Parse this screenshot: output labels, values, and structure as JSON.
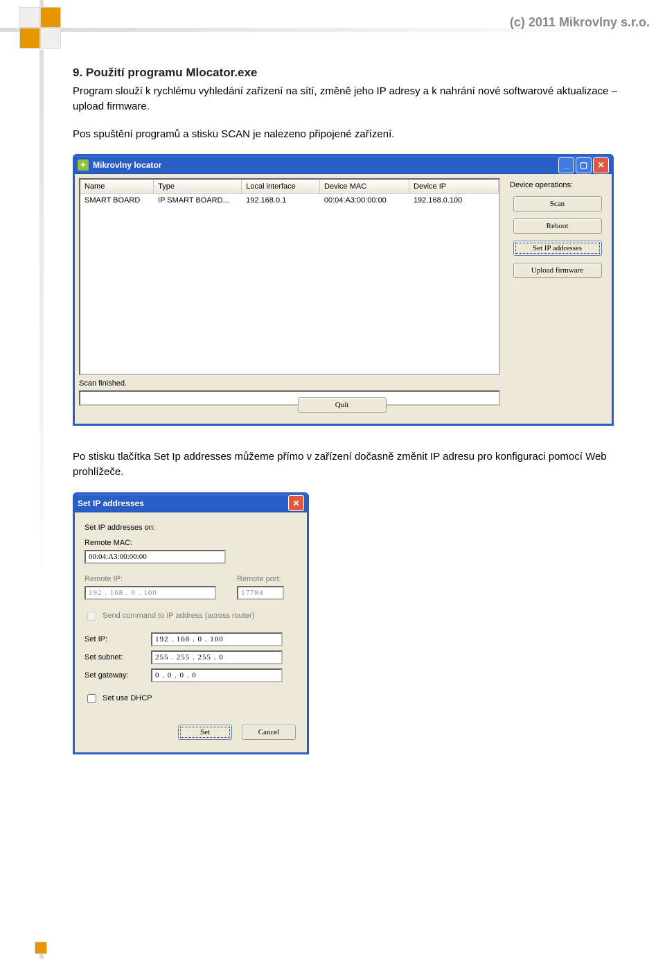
{
  "page": {
    "copyright": "(c) 2011 Mikrovlny s.r.o.",
    "heading": "9. Použití programu Mlocator.exe",
    "para1": "Program slouží k rychlému vyhledání zařízení na sítí, změně jeho IP adresy a k nahrání nové softwarové aktualizace – upload firmware.",
    "para2": "Pos spuštění programů a stisku SCAN je nalezeno připojené zařízení.",
    "para3": "Po stisku tlačítka Set Ip addresses můžeme přímo v zařízení dočasně změnit IP adresu pro konfiguraci pomocí Web prohlížeče."
  },
  "locator": {
    "title": "Mikrovlny locator",
    "columns": [
      "Name",
      "Type",
      "Local interface",
      "Device MAC",
      "Device IP"
    ],
    "row": {
      "name": "SMART BOARD",
      "type": "IP SMART BOARD...",
      "iface": "192.168.0.1",
      "mac": "00:04:A3:00:00:00",
      "ip": "192.168.0.100"
    },
    "ops_label": "Device operations:",
    "scan": "Scan",
    "reboot": "Reboot",
    "setip": "Set IP addresses",
    "upload": "Upload firmware",
    "status": "Scan finished.",
    "quit": "Quit"
  },
  "dlg": {
    "title": "Set IP addresses",
    "l_on": "Set IP addresses on:",
    "l_mac": "Remote MAC:",
    "v_mac": "00:04:A3:00:00:00",
    "l_rip": "Remote IP:",
    "v_rip": "192 . 168 .  0  . 100",
    "l_rport": "Remote port:",
    "v_rport": "17784",
    "chk_router": "Send command to IP address (across router)",
    "l_setip": "Set IP:",
    "v_setip": "192 . 168 .  0  . 100",
    "l_setsub": "Set subnet:",
    "v_setsub": "255 . 255 . 255 .  0",
    "l_setgw": "Set gateway:",
    "v_setgw": " 0  .  0  .  0  .  0",
    "chk_dhcp": "Set use DHCP",
    "btn_set": "Set",
    "btn_cancel": "Cancel"
  }
}
